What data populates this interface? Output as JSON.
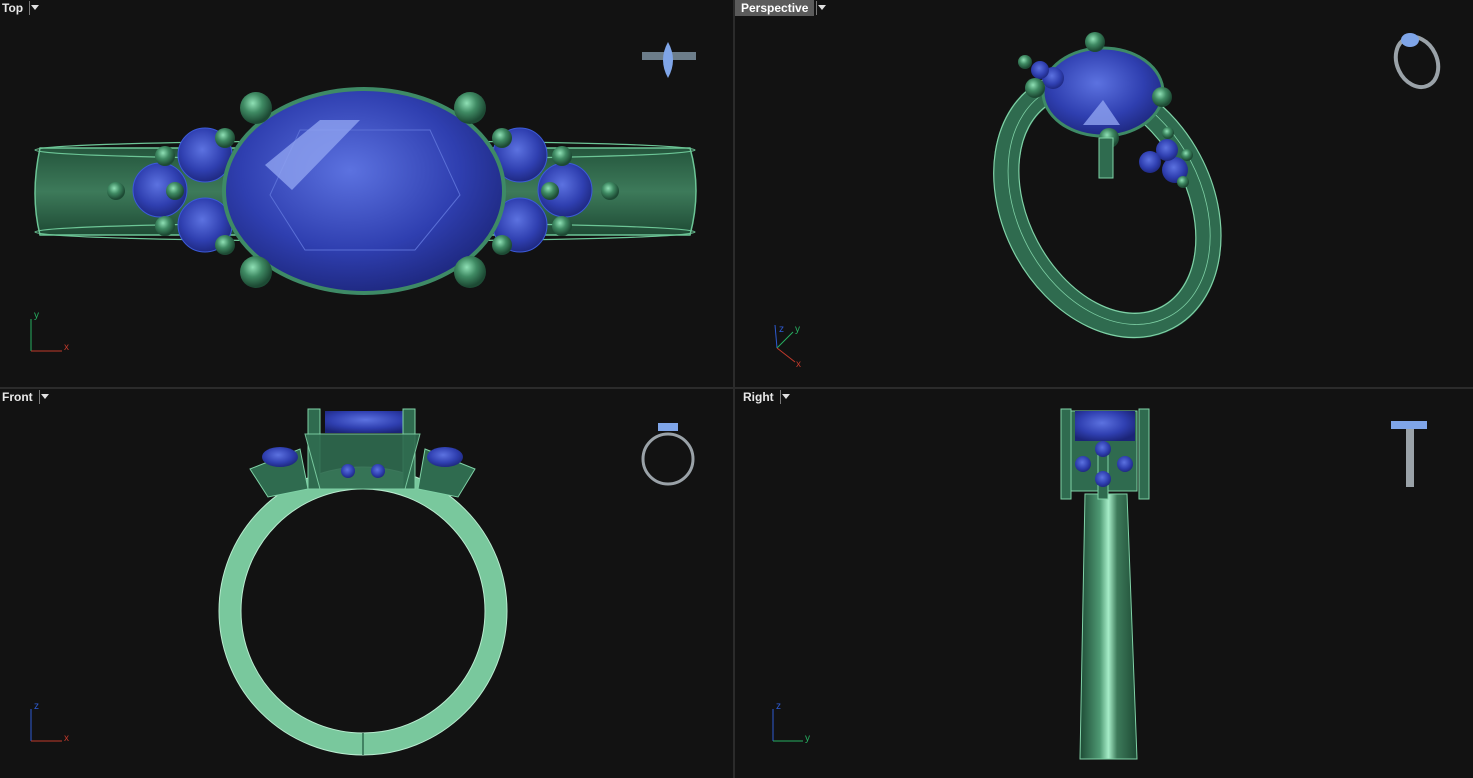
{
  "viewports": {
    "top": {
      "title": "Top",
      "axes": {
        "vertical": "y",
        "horizontal": "x"
      }
    },
    "persp": {
      "title": "Perspective",
      "axes": {
        "a": "z",
        "b": "y",
        "c": "x"
      }
    },
    "front": {
      "title": "Front",
      "axes": {
        "vertical": "z",
        "horizontal": "x"
      }
    },
    "right": {
      "title": "Right",
      "axes": {
        "vertical": "z",
        "horizontal": "y"
      }
    }
  },
  "active_viewport": "Perspective",
  "colors": {
    "background": "#121212",
    "metal": "#2f6b4f",
    "metal_light": "#7fd1a6",
    "gem": "#2c3aa8",
    "gem_light": "#6f86e6",
    "axis_x": "#c0392b",
    "axis_y": "#27ae60",
    "axis_z": "#2e5bd1"
  },
  "icons": {
    "viewport_menu": "chevron-down-icon",
    "preview": "ring-preview-icon"
  }
}
